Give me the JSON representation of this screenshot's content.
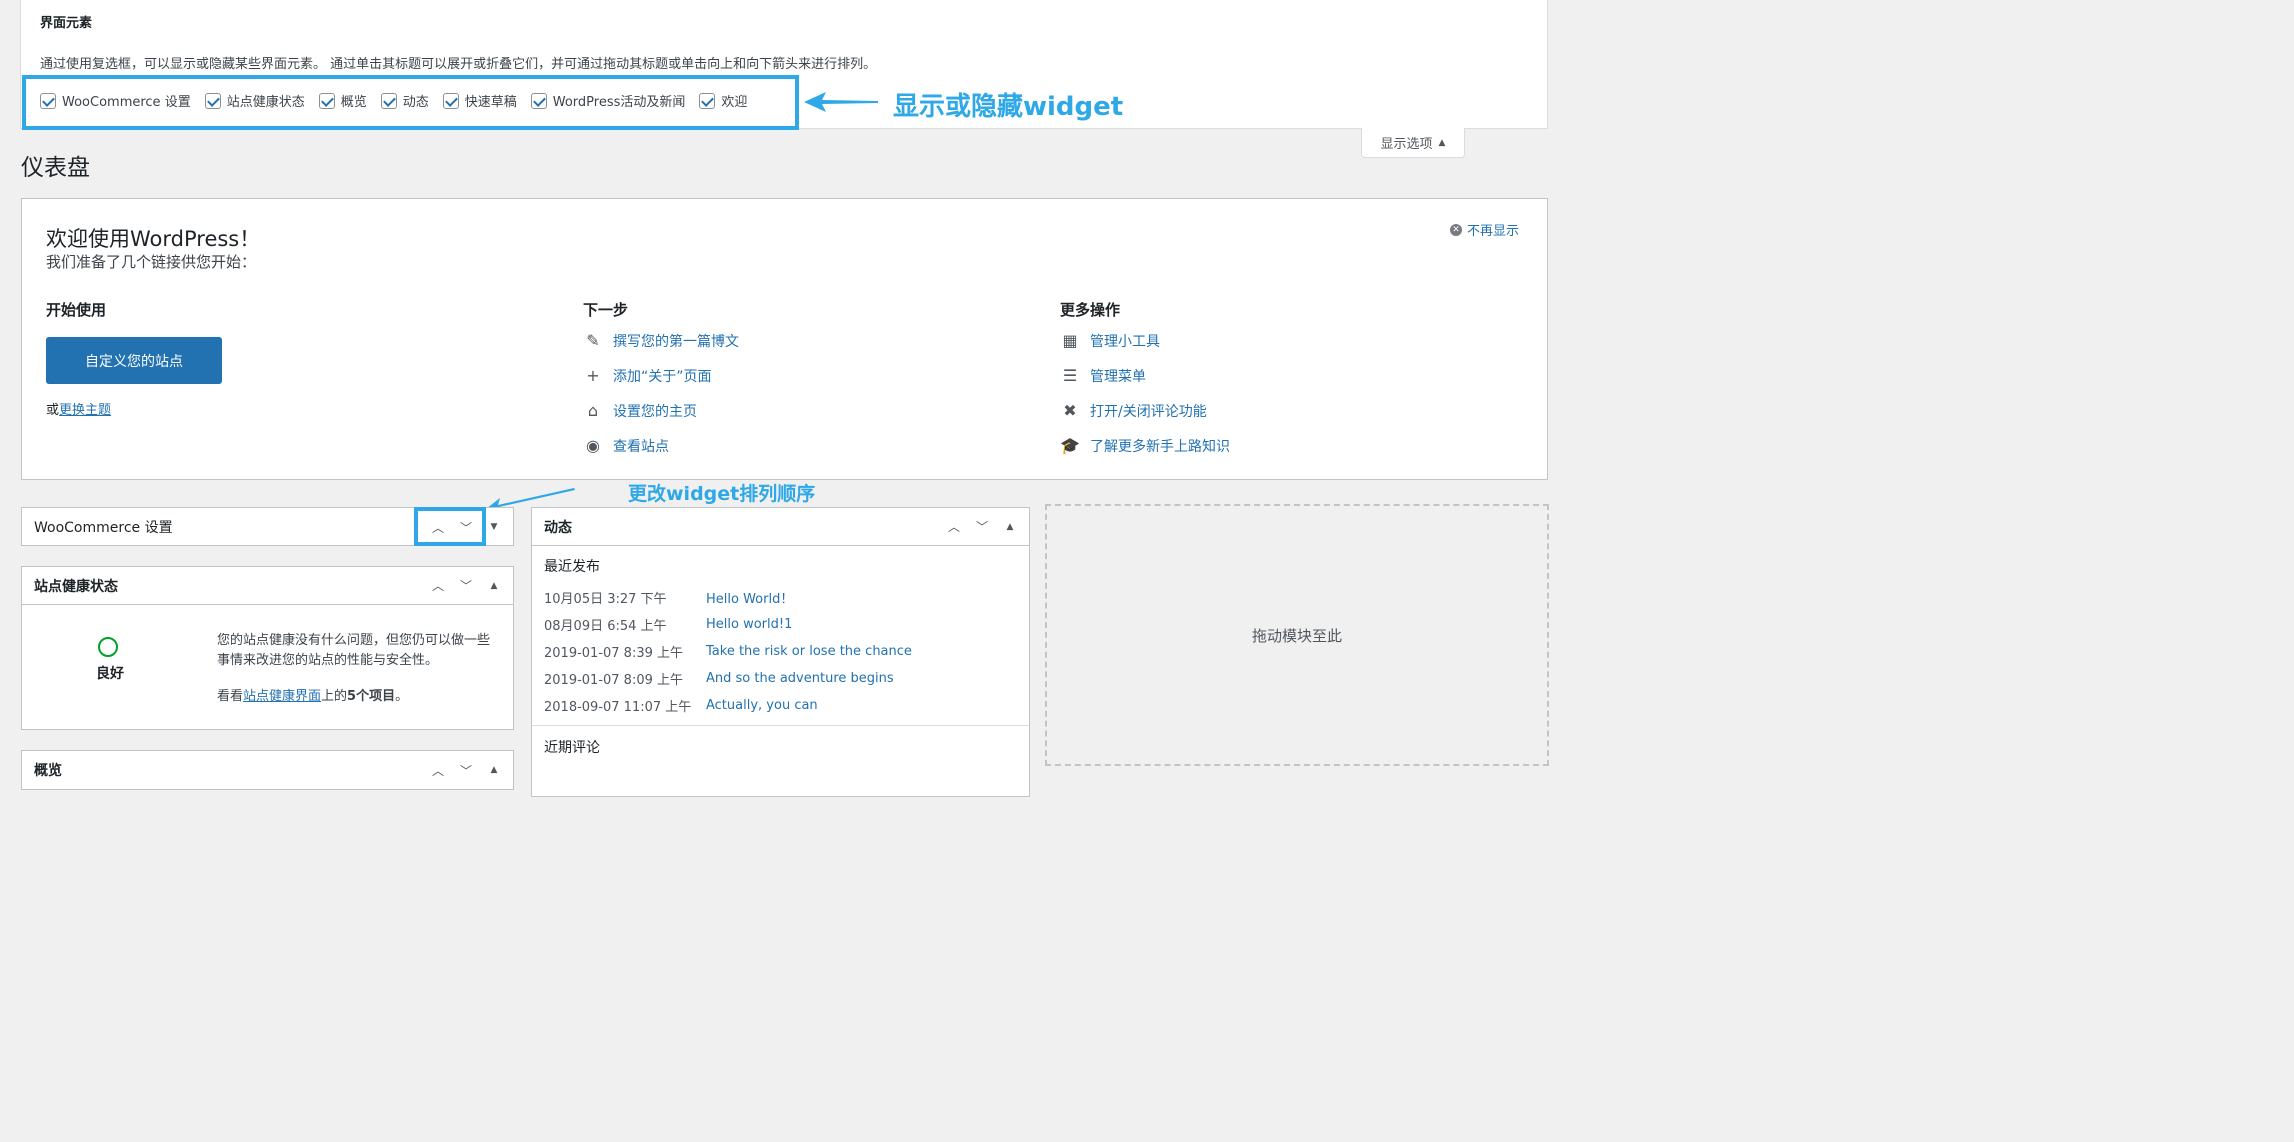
{
  "screen_options": {
    "title": "界面元素",
    "description": "通过使用复选框，可以显示或隐藏某些界面元素。 通过单击其标题可以展开或折叠它们，并可通过拖动其标题或单击向上和向下箭头来进行排列。",
    "checkboxes": [
      {
        "label": "WooCommerce 设置",
        "checked": true
      },
      {
        "label": "站点健康状态",
        "checked": true
      },
      {
        "label": "概览",
        "checked": true
      },
      {
        "label": "动态",
        "checked": true
      },
      {
        "label": "快速草稿",
        "checked": true
      },
      {
        "label": "WordPress活动及新闻",
        "checked": true
      },
      {
        "label": "欢迎",
        "checked": true
      }
    ],
    "tab_label": "显示选项"
  },
  "annotations": {
    "show_hide": "显示或隐藏widget",
    "reorder": "更改widget排列顺序",
    "color": "#2ea8e6"
  },
  "page_title": "仪表盘",
  "welcome": {
    "title": "欢迎使用WordPress！",
    "subtitle": "我们准备了几个链接供您开始：",
    "dismiss": "不再显示",
    "col1": {
      "heading": "开始使用",
      "button": "自定义您的站点",
      "or_prefix": "或",
      "or_link": "更换主题"
    },
    "col2": {
      "heading": "下一步",
      "items": [
        {
          "icon": "edit-icon",
          "label": "撰写您的第一篇博文"
        },
        {
          "icon": "plus-icon",
          "label": "添加“关于”页面"
        },
        {
          "icon": "home-icon",
          "label": "设置您的主页"
        },
        {
          "icon": "view-icon",
          "label": "查看站点"
        }
      ]
    },
    "col3": {
      "heading": "更多操作",
      "items": [
        {
          "icon": "widgets-icon",
          "label": "管理小工具"
        },
        {
          "icon": "menu-icon",
          "label": "管理菜单"
        },
        {
          "icon": "comments-icon",
          "label": "打开/关闭评论功能"
        },
        {
          "icon": "learn-icon",
          "label": "了解更多新手上路知识"
        }
      ]
    }
  },
  "widgets": {
    "woocommerce": {
      "title": "WooCommerce 设置"
    },
    "site_health": {
      "title": "站点健康状态",
      "status": "良好",
      "text": "您的站点健康没有什么问题，但您仍可以做一些事情来改进您的站点的性能与安全性。",
      "prefix": "看看",
      "link": "站点健康界面",
      "mid": "上的",
      "count": "5个项目",
      "suffix": "。"
    },
    "overview": {
      "title": "概览"
    },
    "activity": {
      "title": "动态",
      "recent_label": "最近发布",
      "posts": [
        {
          "date": "10月05日 3:27 下午",
          "title": "Hello World！"
        },
        {
          "date": "08月09日 6:54 上午",
          "title": "Hello world!1"
        },
        {
          "date": "2019-01-07 8:39 上午",
          "title": "Take the risk or lose the chance"
        },
        {
          "date": "2019-01-07 8:09 上午",
          "title": "And so the adventure begins"
        },
        {
          "date": "2018-09-07 11:07 上午",
          "title": "Actually, you can"
        }
      ],
      "comments_label": "近期评论"
    },
    "dropzone": "拖动模块至此"
  }
}
